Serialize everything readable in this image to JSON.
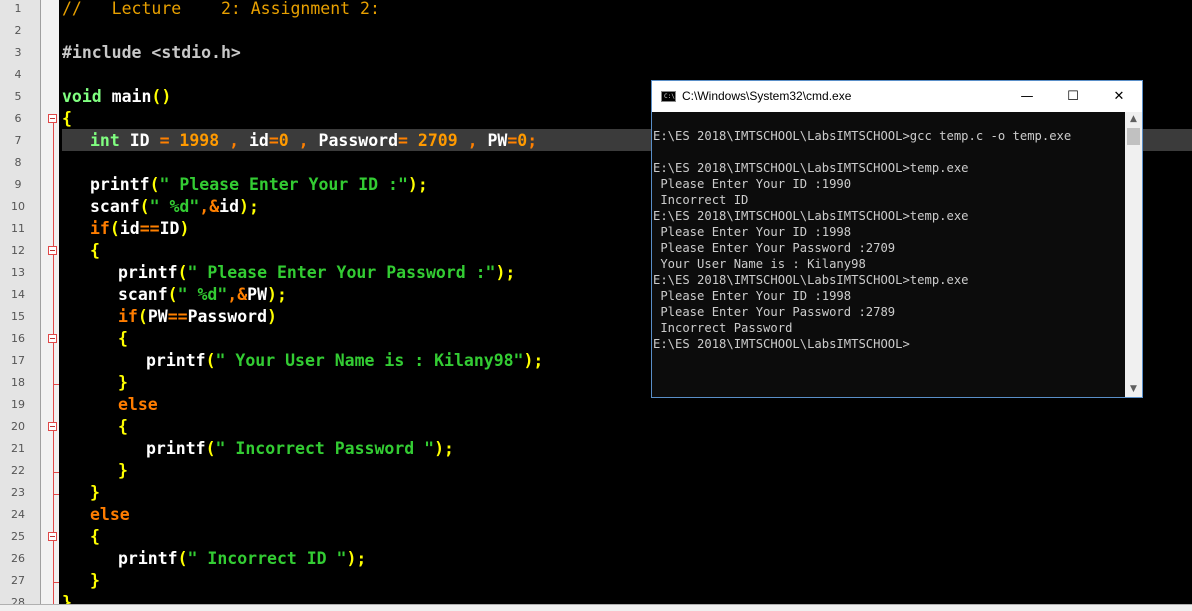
{
  "editor": {
    "line_numbers": [
      "1",
      "2",
      "3",
      "4",
      "5",
      "6",
      "7",
      "8",
      "9",
      "10",
      "11",
      "12",
      "13",
      "14",
      "15",
      "16",
      "17",
      "18",
      "19",
      "20",
      "21",
      "22",
      "23",
      "24",
      "25",
      "26",
      "27",
      "28"
    ],
    "current_line": "7",
    "lines": {
      "l1": "//   Lecture    2: Assignment 2:",
      "l3": "#include <stdio.h>",
      "l5_kw": "void",
      "l5_name": " main",
      "l5_paren": "()",
      "l6": "{",
      "l7_type": "int",
      "l7_a": " ID ",
      "l7_eq1": "=",
      "l7_n1": " 1998 ",
      "l7_c1": ",",
      "l7_b": " id",
      "l7_eq2": "=",
      "l7_n2": "0",
      "l7_c2": " , ",
      "l7_c": "Password",
      "l7_eq3": "=",
      "l7_n3": " 2709 ",
      "l7_c3": ",",
      "l7_d": " PW",
      "l7_eq4": "=",
      "l7_n4": "0",
      "l7_semi": ";",
      "l9_fn": "printf",
      "l9_p1": "(",
      "l9_str": "\" Please Enter Your ID :\"",
      "l9_p2": ");",
      "l10_fn": "scanf",
      "l10_p1": "(",
      "l10_str": "\" %d\"",
      "l10_c": ",",
      "l10_amp": "&",
      "l10_v": "id",
      "l10_p2": ");",
      "l11_kw": "if",
      "l11_p1": "(",
      "l11_a": "id",
      "l11_op": "==",
      "l11_b": "ID",
      "l11_p2": ")",
      "l12": "{",
      "l13_fn": "printf",
      "l13_p1": "(",
      "l13_str": "\" Please Enter Your Password :\"",
      "l13_p2": ");",
      "l14_fn": "scanf",
      "l14_p1": "(",
      "l14_str": "\" %d\"",
      "l14_c": ",",
      "l14_amp": "&",
      "l14_v": "PW",
      "l14_p2": ");",
      "l15_kw": "if",
      "l15_p1": "(",
      "l15_a": "PW",
      "l15_op": "==",
      "l15_b": "Password",
      "l15_p2": ")",
      "l16": "{",
      "l17_fn": "printf",
      "l17_p1": "(",
      "l17_str": "\" Your User Name is : Kilany98\"",
      "l17_p2": ");",
      "l18": "}",
      "l19_kw": "else",
      "l20": "{",
      "l21_fn": "printf",
      "l21_p1": "(",
      "l21_str": "\" Incorrect Password \"",
      "l21_p2": ");",
      "l22": "}",
      "l23": "}",
      "l24_kw": "else",
      "l25": "{",
      "l26_fn": "printf",
      "l26_p1": "(",
      "l26_str": "\" Incorrect ID \"",
      "l26_p2": ");",
      "l27": "}",
      "l28": "}"
    }
  },
  "cmd": {
    "title": "C:\\Windows\\System32\\cmd.exe",
    "icon_text": "C:\\",
    "minimize": "—",
    "maximize": "☐",
    "close": "✕",
    "scroll_up": "▲",
    "scroll_down": "▼",
    "lines": [
      "E:\\ES 2018\\IMTSCHOOL\\LabsIMTSCHOOL>gcc temp.c -o temp.exe",
      "",
      "E:\\ES 2018\\IMTSCHOOL\\LabsIMTSCHOOL>temp.exe",
      " Please Enter Your ID :1990",
      " Incorrect ID",
      "E:\\ES 2018\\IMTSCHOOL\\LabsIMTSCHOOL>temp.exe",
      " Please Enter Your ID :1998",
      " Please Enter Your Password :2709",
      " Your User Name is : Kilany98",
      "E:\\ES 2018\\IMTSCHOOL\\LabsIMTSCHOOL>temp.exe",
      " Please Enter Your ID :1998",
      " Please Enter Your Password :2789",
      " Incorrect Password",
      "E:\\ES 2018\\IMTSCHOOL\\LabsIMTSCHOOL>"
    ]
  }
}
